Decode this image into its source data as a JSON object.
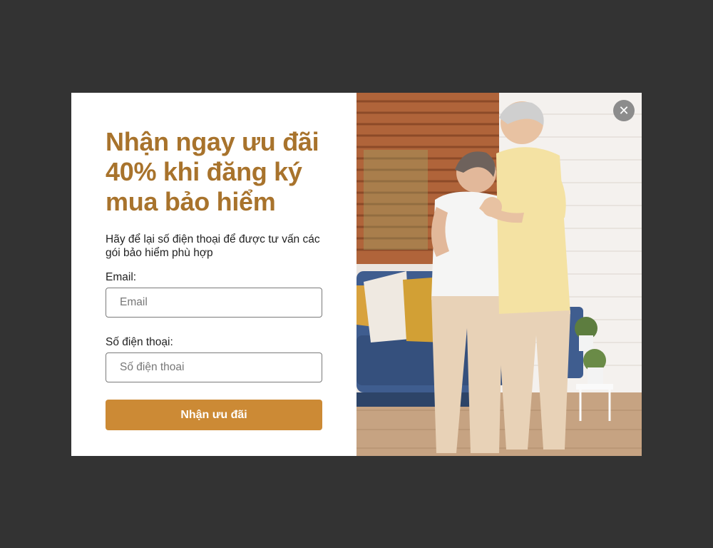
{
  "popup": {
    "headline": "Nhận ngay ưu đãi 40% khi đăng ký mua bảo hiểm",
    "subtext": "Hãy để lại số điện thoại để được tư vấn các gói bảo hiểm phù hợp",
    "email_label": "Email:",
    "email_placeholder": "Email",
    "phone_label": "Số điện thoại:",
    "phone_placeholder": "Số điện thoai",
    "submit_label": "Nhận ưu đãi",
    "close_icon": "close-icon",
    "colors": {
      "headline": "#a8732c",
      "button": "#cc8a35",
      "overlay": "#333333",
      "close": "#8c8c8c"
    }
  }
}
